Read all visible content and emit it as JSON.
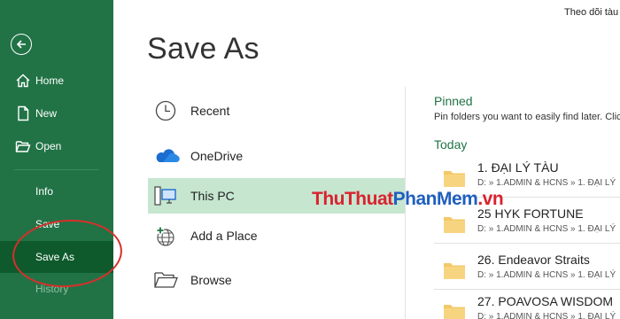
{
  "header": {
    "top_right_text": "Theo dõi tàu ...",
    "title": "Save As"
  },
  "sidebar": {
    "back_icon": "back-arrow-icon",
    "items": [
      {
        "label": "Home",
        "icon": "home-icon"
      },
      {
        "label": "New",
        "icon": "new-document-icon"
      },
      {
        "label": "Open",
        "icon": "open-folder-icon"
      },
      {
        "label": "Info"
      },
      {
        "label": "Save"
      },
      {
        "label": "Save As",
        "active": true
      },
      {
        "label": "History",
        "disabled": true
      }
    ]
  },
  "locations": {
    "items": [
      {
        "label": "Recent",
        "icon": "clock-icon"
      },
      {
        "label": "OneDrive",
        "icon": "cloud-icon"
      },
      {
        "label": "This PC",
        "icon": "computer-icon",
        "selected": true
      },
      {
        "label": "Add a Place",
        "icon": "globe-plus-icon"
      },
      {
        "label": "Browse",
        "icon": "folder-browse-icon"
      }
    ]
  },
  "right_pane": {
    "pinned_heading": "Pinned",
    "pinned_description": "Pin folders you want to easily find later. Clic",
    "today_heading": "Today",
    "folders": [
      {
        "name": "1. ĐẠI LÝ TÀU",
        "path": "D: » 1.ADMIN & HCNS » 1. ĐẠI LÝ"
      },
      {
        "name": "25 HYK FORTUNE",
        "path": "D: » 1.ADMIN & HCNS » 1. ĐẠI LÝ"
      },
      {
        "name": "26. Endeavor Straits",
        "path": "D: » 1.ADMIN & HCNS » 1. ĐẠI LÝ"
      },
      {
        "name": "27. POAVOSA WISDOM",
        "path": "D: » 1.ADMIN & HCNS » 1. ĐẠI LÝ"
      }
    ]
  },
  "watermark": {
    "part1": "ThuThuat",
    "part2": "PhanMem",
    "part3": ".vn"
  },
  "colors": {
    "sidebar_bg": "#217346",
    "sidebar_active": "#0e5a2c",
    "selected_location": "#c6e6d0",
    "accent_green": "#217346",
    "folder_yellow": "#f3c969",
    "annotation_red": "#d6302b"
  }
}
